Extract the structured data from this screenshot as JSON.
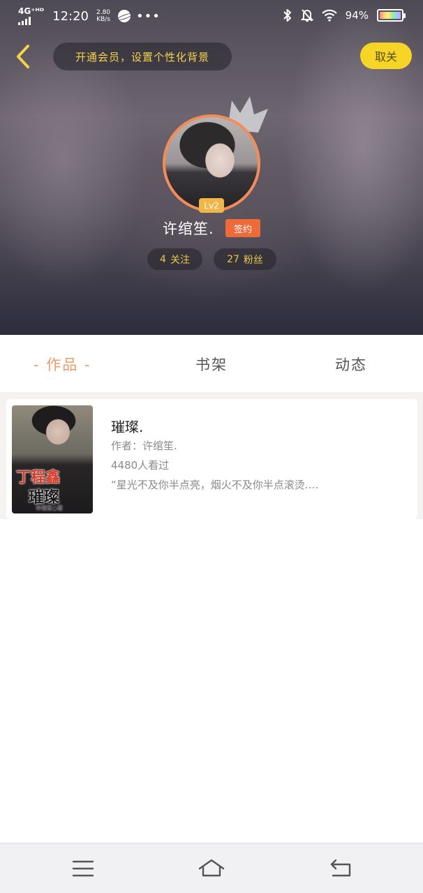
{
  "status_bar": {
    "network": "4G⁺ᴴᴰ",
    "time": "12:20",
    "speed_value": "2.80",
    "speed_unit": "KB/s",
    "more": "•••",
    "battery": "94%"
  },
  "header": {
    "vip_banner": "开通会员，设置个性化背景",
    "cancel_label": "取关"
  },
  "profile": {
    "level": "Lv2",
    "name": "许绾笙.",
    "sign_badge": "签约",
    "following_count": "4",
    "following_label": "关注",
    "fans_count": "27",
    "fans_label": "粉丝"
  },
  "tabs": [
    {
      "label": "- 作品 -",
      "active": true
    },
    {
      "label": "书架",
      "active": false
    },
    {
      "label": "动态",
      "active": false
    }
  ],
  "works": [
    {
      "title": "璀璨.",
      "author": "作者：许绾笙.",
      "views": "4480人看过",
      "excerpt": "“星光不及你半点亮，烟火不及你半点滚烫.…",
      "cover": {
        "title": "丁程鑫",
        "subtitle": "璀璨",
        "author": "许绾笙○著"
      }
    }
  ],
  "colors": {
    "accent_orange": "#f09a6a",
    "sign_badge": "#ee6a3a",
    "cancel_button": "#f7d526",
    "stat_text": "#e9c94a",
    "back_arrow": "#f3d34a"
  },
  "icons": {
    "back": "chevron-left-icon",
    "crown": "crown-icon",
    "bluetooth": "bluetooth-icon",
    "mute": "bell-off-icon",
    "wifi": "wifi-icon",
    "battery": "battery-icon",
    "menu": "menu-icon",
    "home": "home-icon",
    "system_back": "return-icon"
  }
}
